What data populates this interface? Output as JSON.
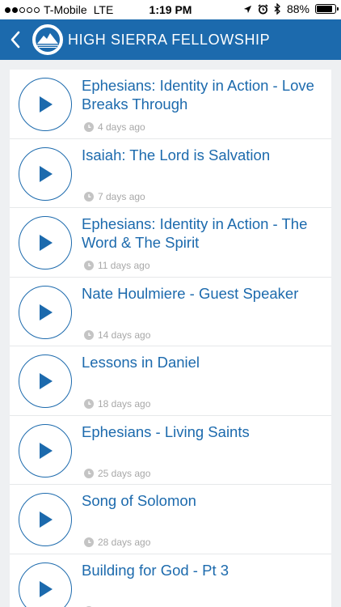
{
  "status_bar": {
    "carrier": "T-Mobile",
    "network": "LTE",
    "time": "1:19 PM",
    "battery": "88%",
    "battery_level": 0.88,
    "signal_bars": 2
  },
  "header": {
    "title": "HIGH SIERRA FELLOWSHIP",
    "color": "#1c6aad"
  },
  "sermons": [
    {
      "title": "Ephesians: Identity in Action - Love Breaks Through",
      "age": "4 days ago"
    },
    {
      "title": "Isaiah: The Lord is Salvation",
      "age": "7 days ago"
    },
    {
      "title": "Ephesians: Identity in Action - The Word & The Spirit",
      "age": "11 days ago"
    },
    {
      "title": "Nate Houlmiere - Guest Speaker",
      "age": "14 days ago"
    },
    {
      "title": "Lessons in Daniel",
      "age": "18 days ago"
    },
    {
      "title": "Ephesians - Living Saints",
      "age": "25 days ago"
    },
    {
      "title": "Song of Solomon",
      "age": "28 days ago"
    },
    {
      "title": "Building for God - Pt 3",
      "age": ""
    }
  ]
}
